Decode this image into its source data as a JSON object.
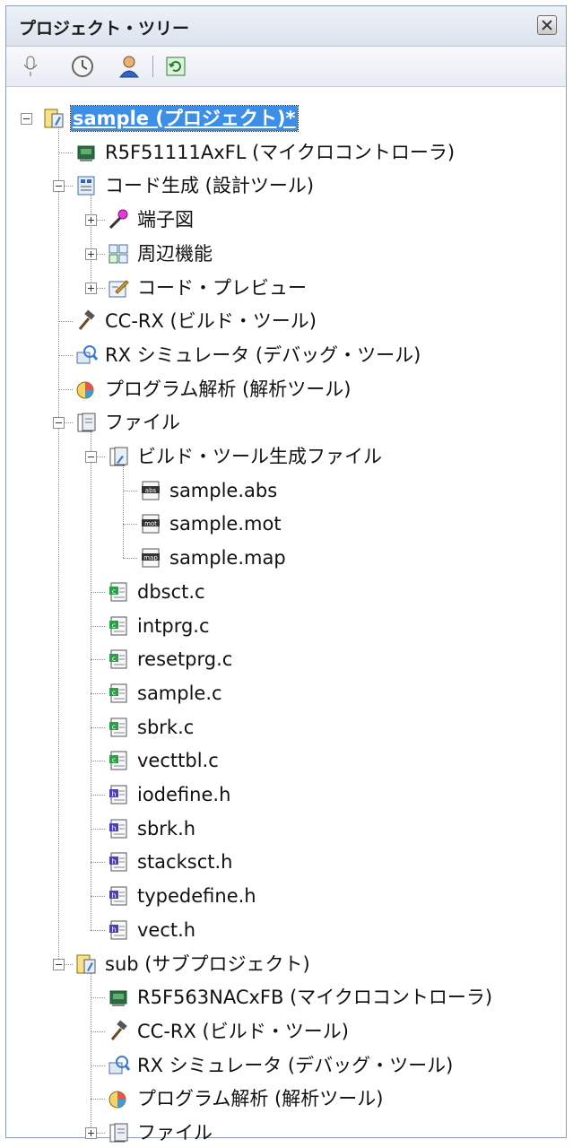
{
  "panel": {
    "title": "プロジェクト・ツリー"
  },
  "toolbar": {
    "buttons": [
      {
        "name": "microphone-icon",
        "tooltip": ""
      },
      {
        "name": "clock-icon",
        "tooltip": ""
      },
      {
        "name": "user-icon",
        "tooltip": ""
      },
      {
        "name": "refresh-icon",
        "tooltip": ""
      }
    ]
  },
  "tree": {
    "root": "sample (プロジェクト)*",
    "items": [
      "R5F51111AxFL (マイクロコントローラ)",
      "コード生成 (設計ツール)",
      "端子図",
      "周辺機能",
      "コード・プレビュー",
      "CC-RX (ビルド・ツール)",
      "RX シミュレータ (デバッグ・ツール)",
      "プログラム解析 (解析ツール)",
      "ファイル",
      "ビルド・ツール生成ファイル",
      "sample.abs",
      "sample.mot",
      "sample.map",
      "dbsct.c",
      "intprg.c",
      "resetprg.c",
      "sample.c",
      "sbrk.c",
      "vecttbl.c",
      "iodefine.h",
      "sbrk.h",
      "stacksct.h",
      "typedefine.h",
      "vect.h",
      "sub (サブプロジェクト)",
      "R5F563NACxFB (マイクロコントローラ)",
      "CC-RX (ビルド・ツール)",
      "RX シミュレータ (デバッグ・ツール)",
      "プログラム解析 (解析ツール)",
      "ファイル"
    ]
  },
  "colors": {
    "selection": "#3d8ee6",
    "border": "#8f9db3"
  }
}
